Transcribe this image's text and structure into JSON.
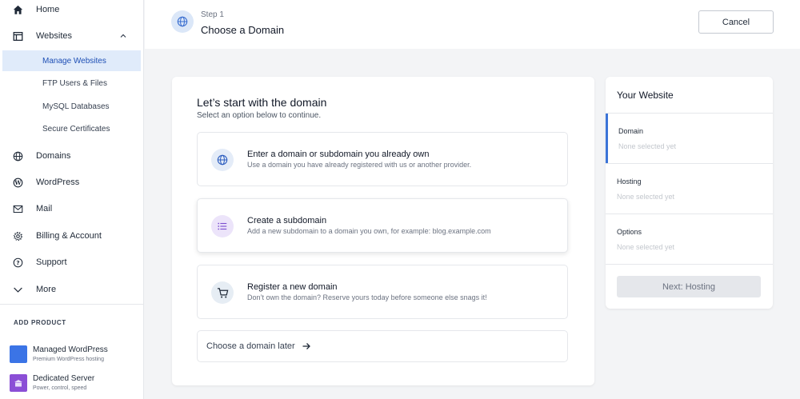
{
  "sidebar": {
    "home": "Home",
    "websites": "Websites",
    "websites_sub": [
      "Manage Websites",
      "FTP Users & Files",
      "MySQL Databases",
      "Secure Certificates"
    ],
    "domains": "Domains",
    "wordpress": "WordPress",
    "mail": "Mail",
    "billing": "Billing & Account",
    "support": "Support",
    "more": "More",
    "add_product_title": "ADD PRODUCT",
    "products": [
      {
        "name": "Managed WordPress",
        "desc": "Premium WordPress hosting",
        "color": "#3b74e6"
      },
      {
        "name": "Dedicated Server",
        "desc": "Power, control, speed",
        "color": "#8b4fd6"
      }
    ]
  },
  "header": {
    "step_label": "Step 1",
    "step_title": "Choose a Domain",
    "cancel_label": "Cancel"
  },
  "main": {
    "title": "Let’s start with the domain",
    "subtitle": "Select an option below to continue.",
    "options": [
      {
        "title": "Enter a domain or subdomain you already own",
        "desc": "Use a domain you have already registered with us or another provider.",
        "icon": "globe-icon"
      },
      {
        "title": "Create a subdomain",
        "desc": "Add a new subdomain to a domain you own, for example: blog.example.com",
        "icon": "list-icon"
      },
      {
        "title": "Register a new domain",
        "desc": "Don’t own the domain? Reserve yours today before someone else snags it!",
        "icon": "cart-icon"
      }
    ],
    "later_label": "Choose a domain later"
  },
  "summary": {
    "title": "Your Website",
    "rows": [
      {
        "label": "Domain",
        "value": "None selected yet"
      },
      {
        "label": "Hosting",
        "value": "None selected yet"
      },
      {
        "label": "Options",
        "value": "None selected yet"
      }
    ],
    "next_label": "Next: Hosting"
  },
  "colors": {
    "accent": "#3b74d8",
    "active_nav_bg": "#e0ebfa",
    "active_nav_text": "#1e4fb5"
  }
}
